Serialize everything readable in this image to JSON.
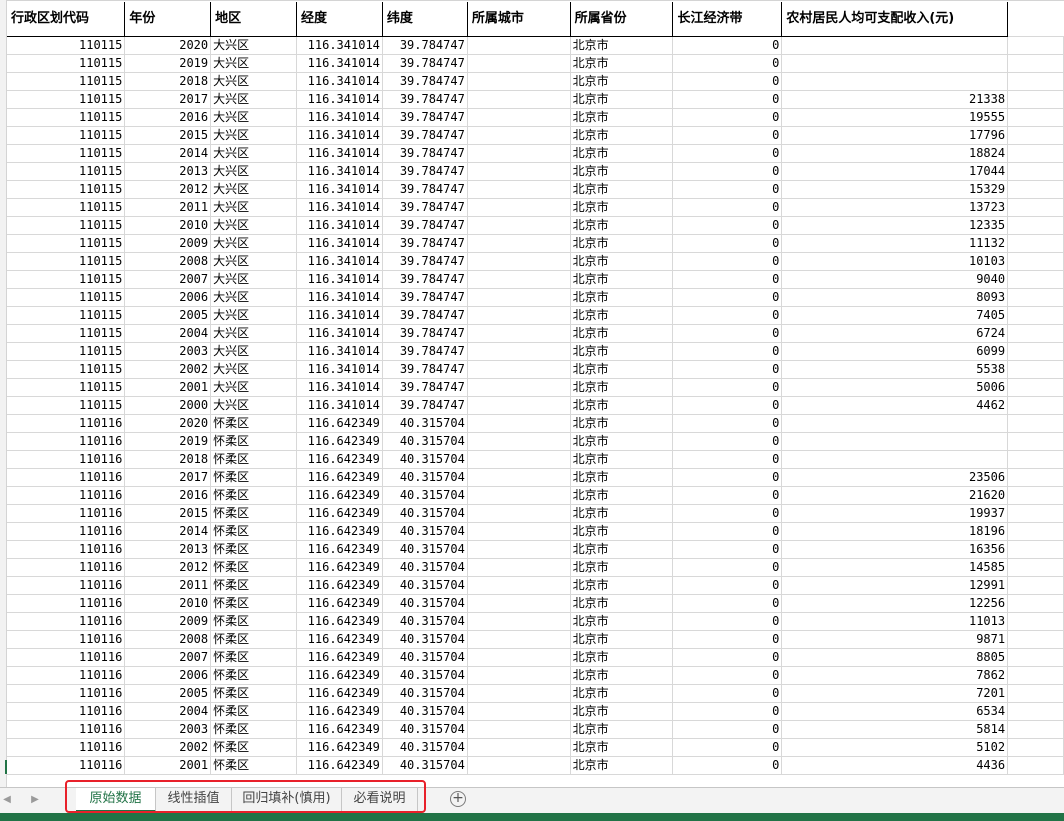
{
  "sheet": {
    "headers": [
      "行政区划代码",
      "年份",
      "地区",
      "经度",
      "纬度",
      "所属城市",
      "所属省份",
      "长江经济带",
      "农村居民人均可支配收入(元)"
    ],
    "rows": [
      [
        "110115",
        "2020",
        "大兴区",
        "116.341014",
        "39.784747",
        "",
        "北京市",
        "0",
        ""
      ],
      [
        "110115",
        "2019",
        "大兴区",
        "116.341014",
        "39.784747",
        "",
        "北京市",
        "0",
        ""
      ],
      [
        "110115",
        "2018",
        "大兴区",
        "116.341014",
        "39.784747",
        "",
        "北京市",
        "0",
        ""
      ],
      [
        "110115",
        "2017",
        "大兴区",
        "116.341014",
        "39.784747",
        "",
        "北京市",
        "0",
        "21338"
      ],
      [
        "110115",
        "2016",
        "大兴区",
        "116.341014",
        "39.784747",
        "",
        "北京市",
        "0",
        "19555"
      ],
      [
        "110115",
        "2015",
        "大兴区",
        "116.341014",
        "39.784747",
        "",
        "北京市",
        "0",
        "17796"
      ],
      [
        "110115",
        "2014",
        "大兴区",
        "116.341014",
        "39.784747",
        "",
        "北京市",
        "0",
        "18824"
      ],
      [
        "110115",
        "2013",
        "大兴区",
        "116.341014",
        "39.784747",
        "",
        "北京市",
        "0",
        "17044"
      ],
      [
        "110115",
        "2012",
        "大兴区",
        "116.341014",
        "39.784747",
        "",
        "北京市",
        "0",
        "15329"
      ],
      [
        "110115",
        "2011",
        "大兴区",
        "116.341014",
        "39.784747",
        "",
        "北京市",
        "0",
        "13723"
      ],
      [
        "110115",
        "2010",
        "大兴区",
        "116.341014",
        "39.784747",
        "",
        "北京市",
        "0",
        "12335"
      ],
      [
        "110115",
        "2009",
        "大兴区",
        "116.341014",
        "39.784747",
        "",
        "北京市",
        "0",
        "11132"
      ],
      [
        "110115",
        "2008",
        "大兴区",
        "116.341014",
        "39.784747",
        "",
        "北京市",
        "0",
        "10103"
      ],
      [
        "110115",
        "2007",
        "大兴区",
        "116.341014",
        "39.784747",
        "",
        "北京市",
        "0",
        "9040"
      ],
      [
        "110115",
        "2006",
        "大兴区",
        "116.341014",
        "39.784747",
        "",
        "北京市",
        "0",
        "8093"
      ],
      [
        "110115",
        "2005",
        "大兴区",
        "116.341014",
        "39.784747",
        "",
        "北京市",
        "0",
        "7405"
      ],
      [
        "110115",
        "2004",
        "大兴区",
        "116.341014",
        "39.784747",
        "",
        "北京市",
        "0",
        "6724"
      ],
      [
        "110115",
        "2003",
        "大兴区",
        "116.341014",
        "39.784747",
        "",
        "北京市",
        "0",
        "6099"
      ],
      [
        "110115",
        "2002",
        "大兴区",
        "116.341014",
        "39.784747",
        "",
        "北京市",
        "0",
        "5538"
      ],
      [
        "110115",
        "2001",
        "大兴区",
        "116.341014",
        "39.784747",
        "",
        "北京市",
        "0",
        "5006"
      ],
      [
        "110115",
        "2000",
        "大兴区",
        "116.341014",
        "39.784747",
        "",
        "北京市",
        "0",
        "4462"
      ],
      [
        "110116",
        "2020",
        "怀柔区",
        "116.642349",
        "40.315704",
        "",
        "北京市",
        "0",
        ""
      ],
      [
        "110116",
        "2019",
        "怀柔区",
        "116.642349",
        "40.315704",
        "",
        "北京市",
        "0",
        ""
      ],
      [
        "110116",
        "2018",
        "怀柔区",
        "116.642349",
        "40.315704",
        "",
        "北京市",
        "0",
        ""
      ],
      [
        "110116",
        "2017",
        "怀柔区",
        "116.642349",
        "40.315704",
        "",
        "北京市",
        "0",
        "23506"
      ],
      [
        "110116",
        "2016",
        "怀柔区",
        "116.642349",
        "40.315704",
        "",
        "北京市",
        "0",
        "21620"
      ],
      [
        "110116",
        "2015",
        "怀柔区",
        "116.642349",
        "40.315704",
        "",
        "北京市",
        "0",
        "19937"
      ],
      [
        "110116",
        "2014",
        "怀柔区",
        "116.642349",
        "40.315704",
        "",
        "北京市",
        "0",
        "18196"
      ],
      [
        "110116",
        "2013",
        "怀柔区",
        "116.642349",
        "40.315704",
        "",
        "北京市",
        "0",
        "16356"
      ],
      [
        "110116",
        "2012",
        "怀柔区",
        "116.642349",
        "40.315704",
        "",
        "北京市",
        "0",
        "14585"
      ],
      [
        "110116",
        "2011",
        "怀柔区",
        "116.642349",
        "40.315704",
        "",
        "北京市",
        "0",
        "12991"
      ],
      [
        "110116",
        "2010",
        "怀柔区",
        "116.642349",
        "40.315704",
        "",
        "北京市",
        "0",
        "12256"
      ],
      [
        "110116",
        "2009",
        "怀柔区",
        "116.642349",
        "40.315704",
        "",
        "北京市",
        "0",
        "11013"
      ],
      [
        "110116",
        "2008",
        "怀柔区",
        "116.642349",
        "40.315704",
        "",
        "北京市",
        "0",
        "9871"
      ],
      [
        "110116",
        "2007",
        "怀柔区",
        "116.642349",
        "40.315704",
        "",
        "北京市",
        "0",
        "8805"
      ],
      [
        "110116",
        "2006",
        "怀柔区",
        "116.642349",
        "40.315704",
        "",
        "北京市",
        "0",
        "7862"
      ],
      [
        "110116",
        "2005",
        "怀柔区",
        "116.642349",
        "40.315704",
        "",
        "北京市",
        "0",
        "7201"
      ],
      [
        "110116",
        "2004",
        "怀柔区",
        "116.642349",
        "40.315704",
        "",
        "北京市",
        "0",
        "6534"
      ],
      [
        "110116",
        "2003",
        "怀柔区",
        "116.642349",
        "40.315704",
        "",
        "北京市",
        "0",
        "5814"
      ],
      [
        "110116",
        "2002",
        "怀柔区",
        "116.642349",
        "40.315704",
        "",
        "北京市",
        "0",
        "5102"
      ],
      [
        "110116",
        "2001",
        "怀柔区",
        "116.642349",
        "40.315704",
        "",
        "北京市",
        "0",
        "4436"
      ]
    ]
  },
  "tabs": {
    "items": [
      {
        "label": "原始数据",
        "active": true
      },
      {
        "label": "线性插值",
        "active": false
      },
      {
        "label": "回归填补(慎用)",
        "active": false
      },
      {
        "label": "必看说明",
        "active": false
      }
    ],
    "add_icon": "plus-circle-icon",
    "nav_icons": [
      "chevron-left-icon",
      "chevron-right-icon"
    ],
    "accent_color": "#217346",
    "highlight_color": "#e8202a"
  }
}
